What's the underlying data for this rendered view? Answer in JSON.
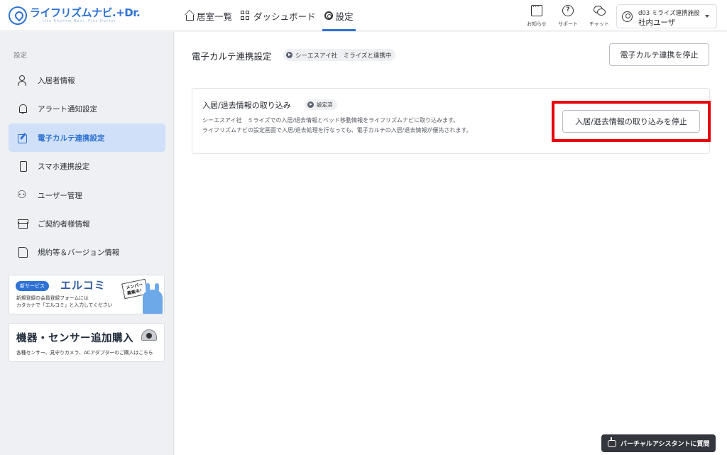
{
  "header": {
    "logo": {
      "name": "ライフリズムナビ.+Dr.",
      "tagline": "Life Rhythm Navi. Plus Doctor"
    },
    "nav": [
      {
        "label": "居室一覧",
        "icon": "home-icon"
      },
      {
        "label": "ダッシュボード",
        "icon": "dashboard-icon"
      },
      {
        "label": "設定",
        "icon": "gear-icon",
        "active": true
      }
    ],
    "utilities": [
      {
        "label": "お知らせ",
        "icon": "notice-icon"
      },
      {
        "label": "サポート",
        "icon": "help-icon",
        "glyph": "?"
      },
      {
        "label": "チャット",
        "icon": "chat-icon"
      }
    ],
    "user": {
      "facility": "d03 ミライズ連携施設",
      "name": "社内ユーザ"
    }
  },
  "sidebar": {
    "heading": "設定",
    "items": [
      {
        "label": "入居者情報",
        "icon": "resident-icon"
      },
      {
        "label": "アラート通知設定",
        "icon": "bell-icon"
      },
      {
        "label": "電子カルテ連携設定",
        "icon": "edit-icon",
        "active": true
      },
      {
        "label": "スマホ連携設定",
        "icon": "smartphone-icon"
      },
      {
        "label": "ユーザー管理",
        "icon": "users-icon"
      },
      {
        "label": "ご契約者様情報",
        "icon": "archive-icon"
      },
      {
        "label": "規約等＆バージョン情報",
        "icon": "document-icon"
      }
    ],
    "banner1": {
      "badge": "新サービス",
      "title": "エルコミ",
      "line1": "新規登録の会員登録フォームには",
      "line2": "カタカナで「エルコミ」と入力してください",
      "sign": "メンバー 募集中！"
    },
    "banner2": {
      "title": "機器・センサー追加購入",
      "text": "各種センサー、見守りカメラ、ACアダプターのご購入はこちら"
    }
  },
  "main": {
    "title": "電子カルテ連携設定",
    "status_tag": "シーエスアイ社　ミライズと連携中",
    "stop_button": "電子カルテ連携を停止",
    "card": {
      "title": "入居/退去情報の取り込み",
      "tag": "設定済",
      "desc1": "シーエスアイ社　ミライズでの入居/退去情報とベッド移動情報をライフリズムナビに取り込みます。",
      "desc2": "ライフリズムナビの設定画面で入居/退去処理を行なっても、電子カルテの入居/退去情報が優先されます。",
      "button": "入居/退去情報の取り込みを停止"
    }
  },
  "assistant": {
    "label": "バーチャルアシスタントに質問"
  },
  "colors": {
    "accent": "#2f72d4",
    "highlight": "#e8000b",
    "active_bg": "#cfe0f8"
  }
}
